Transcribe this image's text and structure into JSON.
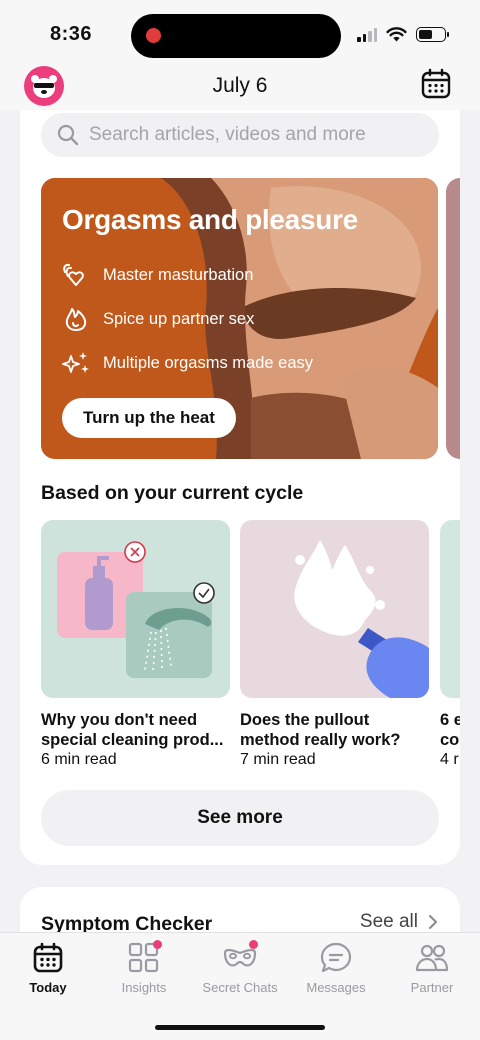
{
  "status_bar": {
    "time": "8:36"
  },
  "header": {
    "title": "July 6"
  },
  "search": {
    "placeholder": "Search articles, videos and more"
  },
  "promo": {
    "title": "Orgasms and pleasure",
    "items": [
      {
        "label": "Master masturbation",
        "icon": "hand-heart-icon"
      },
      {
        "label": "Spice up partner sex",
        "icon": "flame-icon"
      },
      {
        "label": "Multiple orgasms made easy",
        "icon": "sparkles-icon"
      }
    ],
    "button_label": "Turn up the heat",
    "background_color": "#c0581c"
  },
  "cycle_section": {
    "title": "Based on your current cycle",
    "articles": [
      {
        "title": "Why you don't need",
        "title_line2": "special cleaning prod...",
        "meta": "6 min read"
      },
      {
        "title": "Does the pullout",
        "title_line2": "method really work?",
        "meta": "7 min read"
      },
      {
        "title": "6 e",
        "title_line2": "co",
        "meta": "4 r"
      }
    ],
    "see_more_label": "See more"
  },
  "symptom_checker": {
    "title": "Symptom Checker",
    "see_all_label": "See all"
  },
  "tab_bar": {
    "tabs": [
      {
        "label": "Today",
        "icon": "calendar-icon",
        "active": true,
        "badge": false
      },
      {
        "label": "Insights",
        "icon": "grid-icon",
        "active": false,
        "badge": true
      },
      {
        "label": "Secret Chats",
        "icon": "mask-icon",
        "active": false,
        "badge": true
      },
      {
        "label": "Messages",
        "icon": "chat-bubble-icon",
        "active": false,
        "badge": false
      },
      {
        "label": "Partner",
        "icon": "people-icon",
        "active": false,
        "badge": false
      }
    ]
  },
  "colors": {
    "accent": "#ec3d7c",
    "badge": "#ea3f75"
  }
}
